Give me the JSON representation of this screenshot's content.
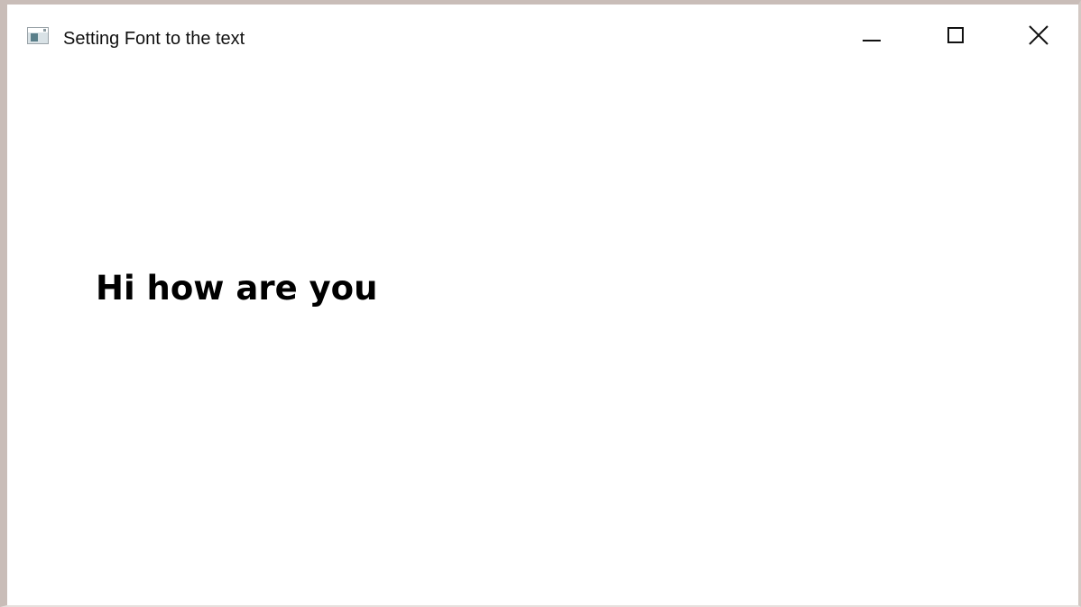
{
  "window": {
    "title": "Setting Font to the text",
    "icon": "application-icon",
    "controls": {
      "minimize_icon": "minimize-icon",
      "maximize_icon": "maximize-icon",
      "close_icon": "close-icon"
    }
  },
  "content": {
    "label_text": "Hi how are you"
  },
  "colors": {
    "background": "#ffffff",
    "text": "#000000",
    "frame": "#c9bdb8"
  }
}
